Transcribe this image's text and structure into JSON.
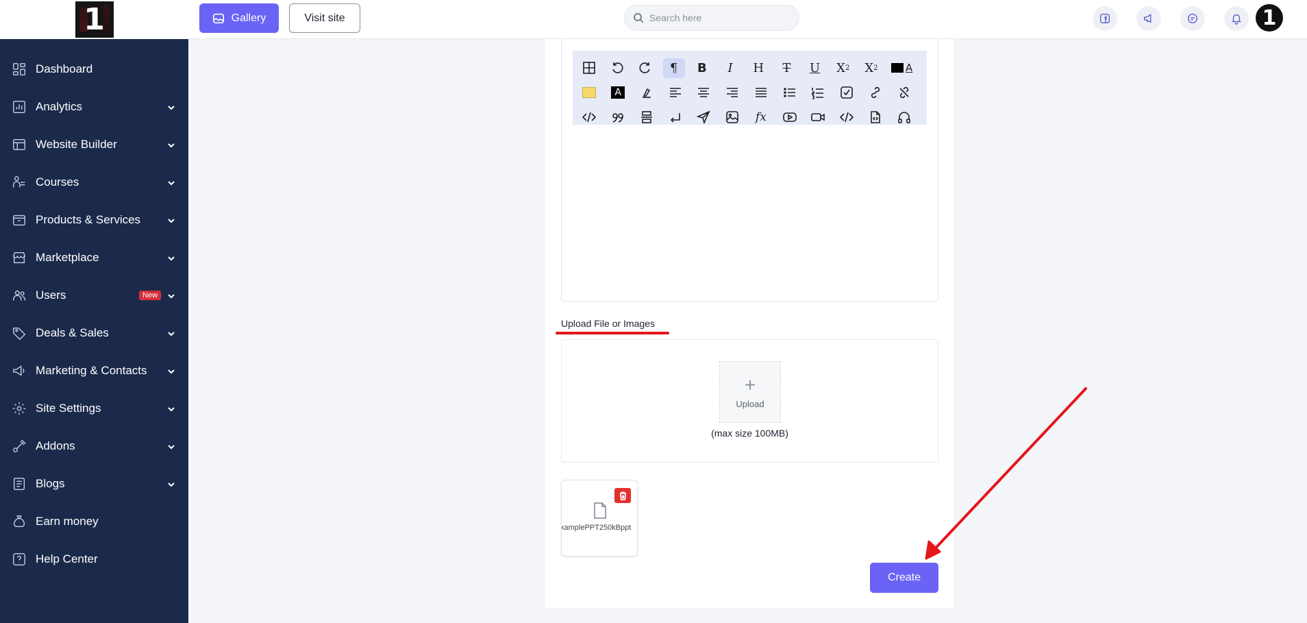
{
  "sidebar": {
    "logo_text": "1",
    "items": [
      {
        "label": "Dashboard",
        "icon": "dashboard-icon",
        "has_chevron": false
      },
      {
        "label": "Analytics",
        "icon": "analytics-icon",
        "has_chevron": true
      },
      {
        "label": "Website Builder",
        "icon": "website-builder-icon",
        "has_chevron": true
      },
      {
        "label": "Courses",
        "icon": "courses-icon",
        "has_chevron": true
      },
      {
        "label": "Products & Services",
        "icon": "products-icon",
        "has_chevron": true
      },
      {
        "label": "Marketplace",
        "icon": "marketplace-icon",
        "has_chevron": true
      },
      {
        "label": "Users",
        "icon": "users-icon",
        "has_chevron": true,
        "badge": "New"
      },
      {
        "label": "Deals & Sales",
        "icon": "tag-icon",
        "has_chevron": true
      },
      {
        "label": "Marketing & Contacts",
        "icon": "megaphone-icon",
        "has_chevron": true
      },
      {
        "label": "Site Settings",
        "icon": "gear-icon",
        "has_chevron": true
      },
      {
        "label": "Addons",
        "icon": "addons-icon",
        "has_chevron": true
      },
      {
        "label": "Blogs",
        "icon": "blog-icon",
        "has_chevron": true
      },
      {
        "label": "Earn money",
        "icon": "money-bag-icon",
        "has_chevron": false
      },
      {
        "label": "Help Center",
        "icon": "help-icon",
        "has_chevron": false
      }
    ]
  },
  "topbar": {
    "gallery_label": "Gallery",
    "visit_site_label": "Visit site",
    "search_placeholder": "Search here",
    "avatar_text": "1"
  },
  "editor": {
    "toolbar_rows": [
      [
        "table",
        "undo",
        "redo",
        "paragraph",
        "bold",
        "italic",
        "heading",
        "strikethrough",
        "underline",
        "subscript",
        "superscript",
        "font-color"
      ],
      [
        "highlight",
        "text-bg",
        "clear-format",
        "align-left",
        "align-center",
        "align-right",
        "justify",
        "bullet-list",
        "ordered-list",
        "checklist",
        "link",
        "unlink"
      ],
      [
        "code",
        "quote",
        "horizontal-rule",
        "line-break",
        "send",
        "image",
        "formula",
        "youtube",
        "video",
        "code-block",
        "file",
        "audio"
      ]
    ]
  },
  "upload": {
    "label": "Upload File or Images",
    "button_label": "Upload",
    "max_size": "(max size 100MB)",
    "files": [
      {
        "name": "xamplePPT250kBppt"
      }
    ]
  },
  "actions": {
    "create_label": "Create"
  },
  "colors": {
    "sidebar_bg": "#1b2a4a",
    "accent": "#6a63f6",
    "annotation_red": "#e4161b",
    "delete_red": "#e03131"
  }
}
